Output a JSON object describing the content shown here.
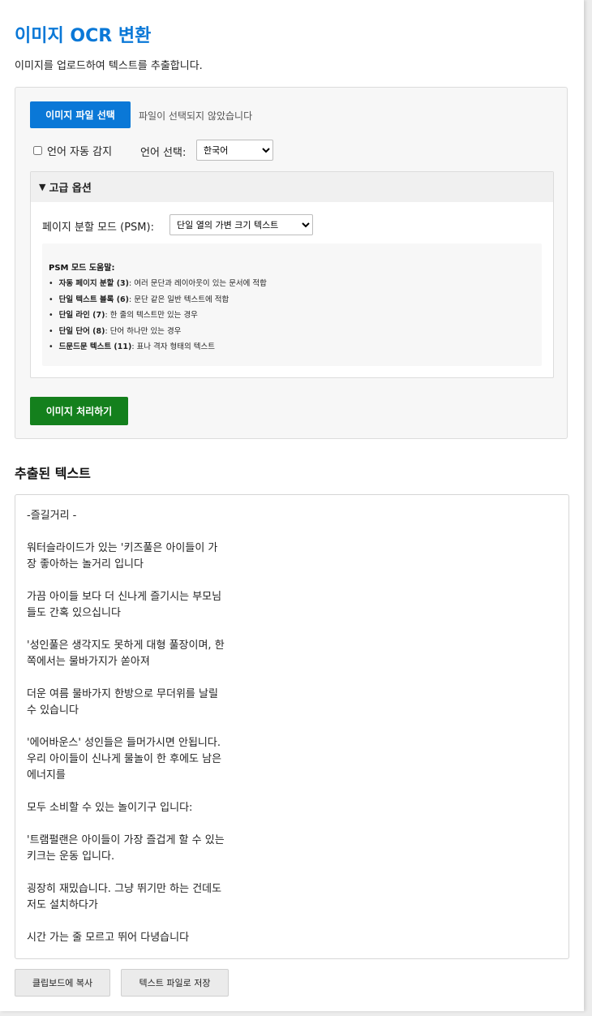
{
  "app": {
    "title": "이미지 OCR 변환",
    "subtitle": "이미지를 업로드하여 텍스트를 추출합니다."
  },
  "upload": {
    "file_button_label": "이미지 파일 선택",
    "file_status": "파일이 선택되지 않았습니다",
    "auto_detect_label": "언어 자동 감지",
    "auto_detect_checked": false,
    "language_label": "언어 선택:",
    "language_selected": "한국어"
  },
  "advanced": {
    "summary_label": "고급 옵션",
    "psm_label": "페이지 분할 모드 (PSM):",
    "psm_selected": "단일 열의 가변 크기 텍스트",
    "help_title": "PSM 모드 도움말:",
    "help_items": [
      {
        "term": "자동 페이지 분할 (3)",
        "desc": ": 여러 문단과 레이아웃이 있는 문서에 적합"
      },
      {
        "term": "단일 텍스트 블록 (6)",
        "desc": ": 문단 같은 일반 텍스트에 적합"
      },
      {
        "term": "단일 라인 (7)",
        "desc": ": 한 줄의 텍스트만 있는 경우"
      },
      {
        "term": "단일 단어 (8)",
        "desc": ": 단어 하나만 있는 경우"
      },
      {
        "term": "드문드문 텍스트 (11)",
        "desc": ": 표나 격자 형태의 텍스트"
      }
    ]
  },
  "process_button_label": "이미지 처리하기",
  "result": {
    "heading": "추출된 텍스트",
    "text": "-즐길거리 -\n\n워터슬라이드가 있는 '키즈풀은 아이들이 가\n장 좋아하는 놀거리 입니다\n\n가끔 아이들 보다 더 신나게 즐기시는 부모님\n들도 간혹 있으십니다\n\n'성인풀은 생각지도 못하게 대형 풀장이며, 한\n쪽에서는 물바가지가 쏟아져\n\n더운 여름 물바가지 한방으로 무더위를 날릴\n수 있습니다\n\n'에어바운스' 성인들은 들머가시면 안됩니다.\n우리 아이들이 신나게 물놀이 한 후에도 남은\n에너지를\n\n모두 소비할 수 있는 놀이기구 입니다:\n\n'트램펄랜은 아이들이 가장 즐겁게 할 수 있는\n키크는 운동 입니다.\n\n굉장히 재밌습니다. 그냥 뛰기만 하는 건데도\n저도 설치하다가\n\n시간 가는 줄 모르고 뛰어 다녕습니다",
    "copy_button_label": "클립보드에 복사",
    "save_button_label": "텍스트 파일로 저장"
  },
  "colors": {
    "accent_blue": "#0a78d7",
    "process_green": "#14801d"
  }
}
